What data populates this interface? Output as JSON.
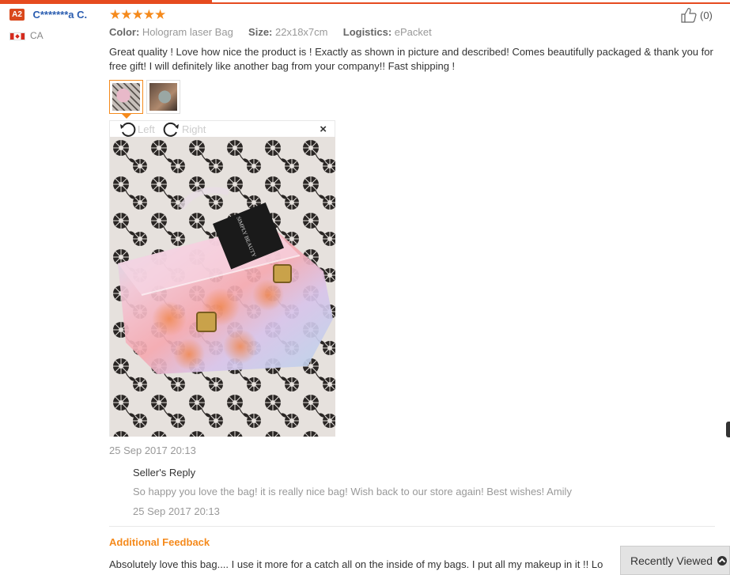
{
  "buyer": {
    "badge": "A2",
    "name": "C*******a C.",
    "country": "CA"
  },
  "rating": {
    "stars": "★★★★★",
    "value": 5
  },
  "like": {
    "count": "(0)"
  },
  "attributes": [
    {
      "key": "Color:",
      "value": "Hologram laser Bag"
    },
    {
      "key": "Size:",
      "value": "22x18x7cm"
    },
    {
      "key": "Logistics:",
      "value": "ePacket"
    }
  ],
  "review": {
    "text": "Great quality ! Love how nice the product is ! Exactly as shown in picture and described! Comes beautifully packaged & thank you for free gift! I will definitely like another bag from your company!! Fast shipping !",
    "date": "25 Sep 2017 20:13"
  },
  "viewer": {
    "rotate_left": "Left",
    "rotate_right": "Right",
    "close": "×",
    "tag_text": "SIMPLY BEAUTY"
  },
  "seller_reply": {
    "title": "Seller's Reply",
    "text": "So happy you love the bag! it is really nice bag! Wish back to our store again! Best wishes! Amily",
    "date": "25 Sep 2017 20:13"
  },
  "additional_feedback": {
    "title": "Additional Feedback",
    "text": "Absolutely love this bag.... I use it more for a catch all on the inside of my bags. I put all my makeup in it !! Lo"
  },
  "recently_viewed": {
    "label": "Recently Viewed"
  },
  "colors": {
    "accent": "#f58a1c",
    "brand": "#e64b1f",
    "link": "#2a5db0"
  }
}
